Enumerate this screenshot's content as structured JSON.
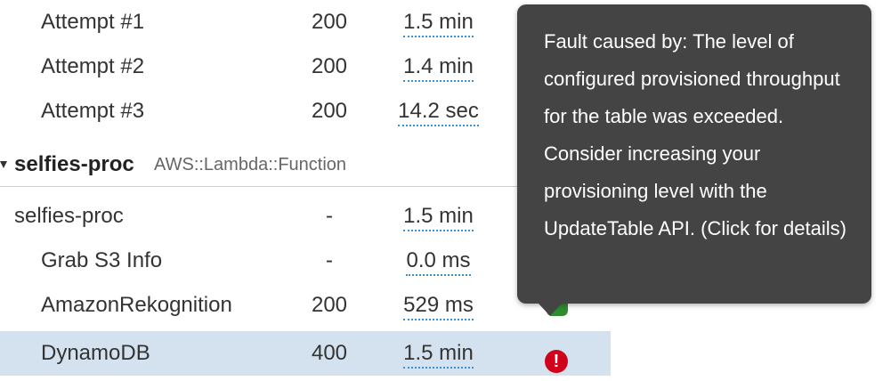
{
  "rows_top": [
    {
      "name": "Attempt #1",
      "status": "200",
      "duration": "1.5 min"
    },
    {
      "name": "Attempt #2",
      "status": "200",
      "duration": "1.4 min"
    },
    {
      "name": "Attempt #3",
      "status": "200",
      "duration": "14.2 sec"
    }
  ],
  "group": {
    "name": "selfies-proc",
    "type": "AWS::Lambda::Function"
  },
  "rows_group": [
    {
      "name": "selfies-proc",
      "status": "-",
      "duration": "1.5 min"
    },
    {
      "name": "Grab S3 Info",
      "status": "-",
      "duration": "0.0 ms"
    },
    {
      "name": "AmazonRekognition",
      "status": "200",
      "duration": "529 ms"
    },
    {
      "name": "DynamoDB",
      "status": "400",
      "duration": "1.5 min",
      "indicator": "!"
    }
  ],
  "tooltip": {
    "text": "Fault caused by: The level of configured provisioned throughput for the table was exceeded. Consider increasing your provisioning level with the UpdateTable API. (Click for details)"
  },
  "colors": {
    "fault": "#d0021b",
    "ok": "#2e8b2e",
    "selected_row": "#d4e2ef",
    "tooltip_bg": "#444444",
    "duration_underline": "#3b8fd3"
  },
  "icons": {
    "fault_indicator": "exclamation-circle-icon",
    "ok_indicator": "check-icon",
    "group_toggle": "caret-down-icon"
  }
}
